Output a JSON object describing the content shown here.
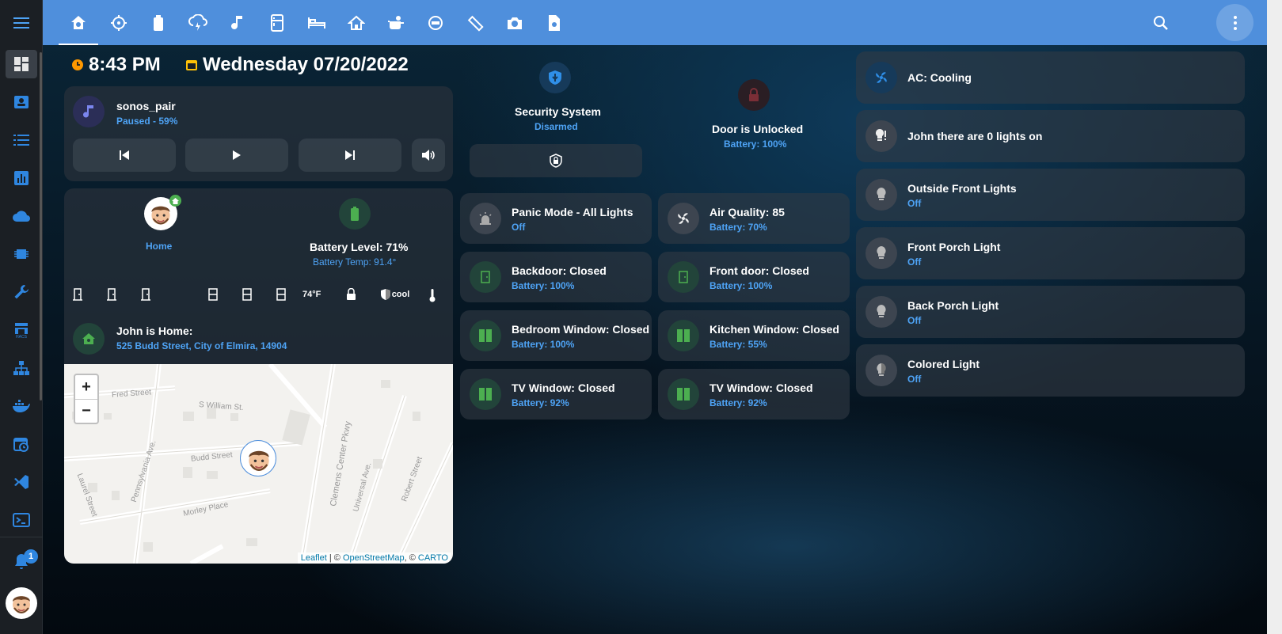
{
  "header": {
    "tabs": [
      "home",
      "robot-vacuum",
      "battery",
      "weather",
      "music",
      "fridge",
      "bedroom",
      "house",
      "kitchen",
      "washer",
      "ruler",
      "camera",
      "settings"
    ]
  },
  "sidebar": {
    "items": [
      "dashboard",
      "person-card",
      "list",
      "chart",
      "cloud",
      "chip",
      "wrench",
      "hacs",
      "network",
      "docker",
      "calendar-clock",
      "vscode",
      "terminal"
    ],
    "notification_count": "1"
  },
  "clock": {
    "time": "8:43 PM",
    "date": "Wednesday 07/20/2022"
  },
  "media": {
    "name": "sonos_pair",
    "status": "Paused - 59%"
  },
  "person": {
    "state": "Home",
    "battery_title": "Battery Level: 71%",
    "battery_temp": "Battery Temp: 91.4°",
    "temp": "74°F",
    "mode": "cool",
    "location_title": "John is Home:",
    "address": "525 Budd Street, City of Elmira, 14904"
  },
  "map": {
    "zoom_in": "+",
    "zoom_out": "−",
    "attr_leaflet": "Leaflet",
    "attr_sep1": " | © ",
    "attr_osm": "OpenStreetMap",
    "attr_sep2": ", © ",
    "attr_carto": "CARTO",
    "streets": [
      "Fred Street",
      "S William St.",
      "Budd Street",
      "Pennsylvania Ave.",
      "Morley Place",
      "Laurel Street",
      "Clemens Center Pkwy",
      "Universal Ave.",
      "Robert Street"
    ]
  },
  "security": {
    "title": "Security System",
    "state": "Disarmed"
  },
  "door": {
    "title": "Door is Unlocked",
    "battery": "Battery: 100%"
  },
  "tiles": [
    {
      "name": "Panic Mode - All Lights",
      "sub": "Off"
    },
    {
      "name": "Air Quality: 85",
      "sub": "Battery: 70%"
    },
    {
      "name": "Backdoor: Closed",
      "sub": "Battery: 100%"
    },
    {
      "name": "Front door: Closed",
      "sub": "Battery: 100%"
    },
    {
      "name": "Bedroom Window: Closed",
      "sub": "Battery: 100%"
    },
    {
      "name": "Kitchen Window: Closed",
      "sub": "Battery: 55%"
    },
    {
      "name": "TV Window: Closed",
      "sub": "Battery: 92%"
    },
    {
      "name": "TV Window: Closed",
      "sub": "Battery: 92%"
    }
  ],
  "right": [
    {
      "name": "AC: Cooling",
      "sub": ""
    },
    {
      "name": "John there are 0 lights on",
      "sub": ""
    },
    {
      "name": "Outside Front Lights",
      "sub": "Off"
    },
    {
      "name": "Front Porch Light",
      "sub": "Off"
    },
    {
      "name": "Back Porch Light",
      "sub": "Off"
    },
    {
      "name": "Colored Light",
      "sub": "Off"
    }
  ],
  "colors": {
    "topbar": "#4f8fdc",
    "accent": "#4ea3f5",
    "green": "#4caf50",
    "orange": "#ff9800",
    "yellow": "#ffc107"
  }
}
